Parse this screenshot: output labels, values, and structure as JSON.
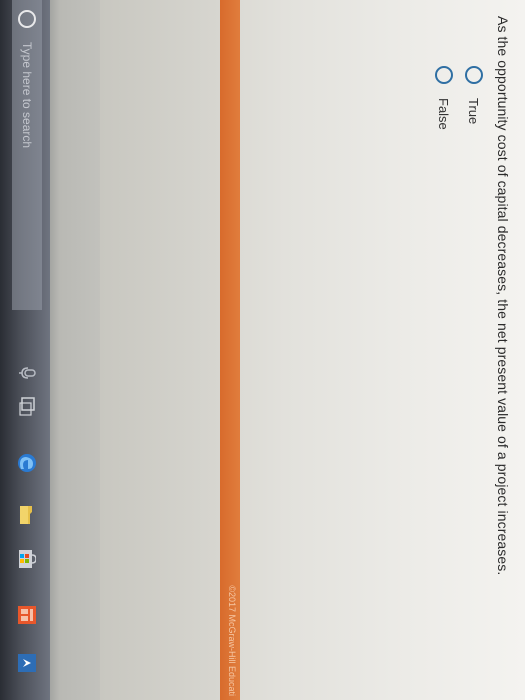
{
  "question": {
    "text": "As the opportunity cost of capital decreases, the net present value of a project increases."
  },
  "options": [
    {
      "label": "True",
      "selected": false
    },
    {
      "label": "False",
      "selected": false
    }
  ],
  "footer": {
    "copyright": "©2017 McGraw-Hill Educati"
  },
  "taskbar": {
    "search_placeholder": "Type here to search",
    "icons": [
      "cortana-icon",
      "microphone-icon",
      "task-view-icon",
      "edge-icon",
      "file-explorer-icon",
      "store-icon",
      "office-icon",
      "app-icon"
    ]
  },
  "colors": {
    "accent_orange": "#dd7335",
    "radio_blue": "#2f6fa3",
    "taskbar": "#3c4048"
  }
}
